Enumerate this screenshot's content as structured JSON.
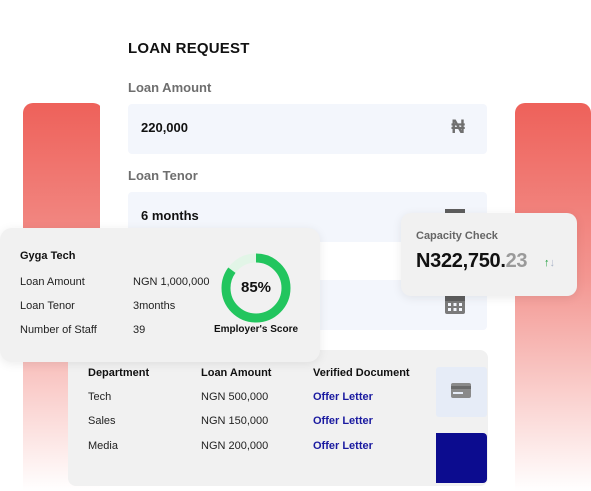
{
  "loan_request": {
    "title": "LOAN REQUEST",
    "amount_label": "Loan Amount",
    "amount_value": "220,000",
    "currency_symbol": "₦",
    "tenor_label": "Loan Tenor",
    "tenor_value": "6 months"
  },
  "company_card": {
    "name": "Gyga Tech",
    "rows": [
      {
        "label": "Loan Amount",
        "value": "NGN 1,000,000"
      },
      {
        "label": "Loan Tenor",
        "value": "3months"
      },
      {
        "label": "Number of Staff",
        "value": "39"
      }
    ],
    "score_percent": 85,
    "score_text": "85%",
    "score_caption": "Employer's Score",
    "score_color": "#22c55e"
  },
  "capacity_card": {
    "label": "Capacity Check",
    "amount_main": "N322,750.",
    "amount_cents": "23",
    "up_arrow": "↑",
    "down_arrow": "↓"
  },
  "department_table": {
    "headers": [
      "Department",
      "Loan Amount",
      "Verified Document"
    ],
    "rows": [
      [
        "Tech",
        "NGN 500,000",
        "Offer Letter"
      ],
      [
        "Sales",
        "NGN 150,000",
        "Offer Letter"
      ],
      [
        "Media",
        "NGN 200,000",
        "Offer Letter"
      ]
    ]
  },
  "colors": {
    "accent_red": "#ee615a",
    "brand_navy": "#0c0c8f",
    "link_blue": "#1a1aa0",
    "success_green": "#22c55e"
  },
  "icons": {
    "calendar": "calendar-icon",
    "document": "document-card-icon",
    "currency": "naira-icon"
  }
}
